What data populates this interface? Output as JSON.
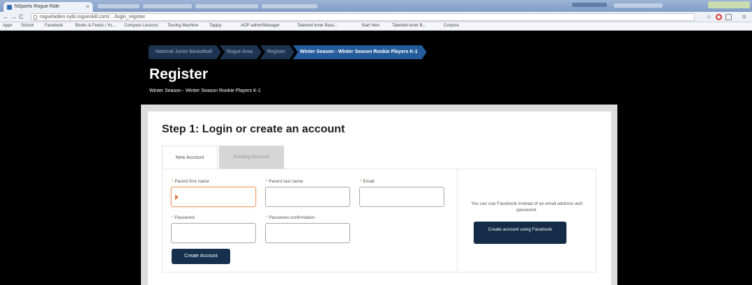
{
  "browser": {
    "tab_title": "NSports Rogue Ride",
    "url": "rogueladies-nybl.rogueskill.com/…/login_register",
    "bookmarks": [
      "Apps",
      "School",
      "Facebook",
      "Books & Feeds | Yo...",
      "Compare Lessons",
      "Touring Machine",
      "Tapjoy",
      "AOP admin/Manager",
      "Talented tuner Bass...",
      "Start here",
      "Talented tuner B...",
      "Corpora"
    ]
  },
  "breadcrumb": [
    {
      "label": "National Junior Basketball"
    },
    {
      "label": "Rogue Area"
    },
    {
      "label": "Register"
    },
    {
      "label": "Winter Season - Winter Season Rookie Players K-1",
      "active": true
    }
  ],
  "page": {
    "title": "Register",
    "subtitle": "Winter Season - Winter Season Rookie Players K-1"
  },
  "step": {
    "title": "Step 1: Login or create an account",
    "tabs": {
      "new": "New Account",
      "existing": "Existing Account"
    }
  },
  "form": {
    "first_name_label": "Parent first name",
    "last_name_label": "Parent last name",
    "email_label": "Email",
    "password_label": "Password",
    "password_confirmation_label": "Password confirmation",
    "required_marker": "*",
    "create_button": "Create Account"
  },
  "facebook": {
    "text": "You can use Facebook instead of an email address and password.",
    "button": "Create account using Facebook"
  },
  "colors": {
    "header_bg": "#000000",
    "breadcrumb_active": "#245c9b",
    "button_dark": "#16304d",
    "required": "#e07c3e"
  }
}
